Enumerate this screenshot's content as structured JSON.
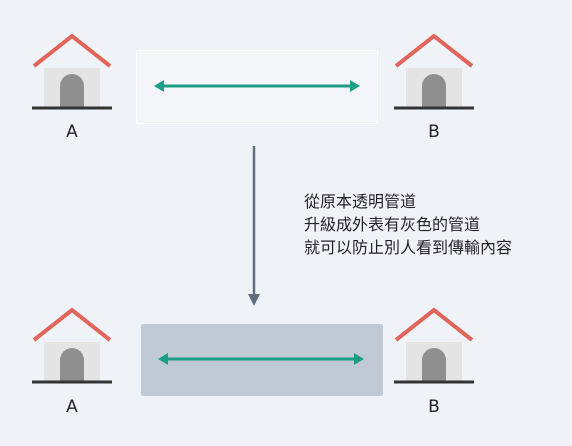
{
  "top": {
    "node_a_label": "A",
    "node_b_label": "B"
  },
  "bottom": {
    "node_a_label": "A",
    "node_b_label": "B"
  },
  "caption": {
    "lines": [
      "從原本透明管道",
      "升級成外表有灰色的管道",
      "就可以防止別人看到傳輸內容"
    ]
  },
  "colors": {
    "background": "#eff2f7",
    "roof": "#e0655a",
    "house_body": "#e4e4e4",
    "door": "#8f8f8f",
    "ground": "#333333",
    "link_arrow": "#1e9e87",
    "down_arrow": "#5f6f80",
    "gray_pipe": "#bfcad6"
  },
  "icons": {
    "house": "house-icon",
    "link": "double-arrow-icon",
    "transition": "down-arrow-icon"
  }
}
